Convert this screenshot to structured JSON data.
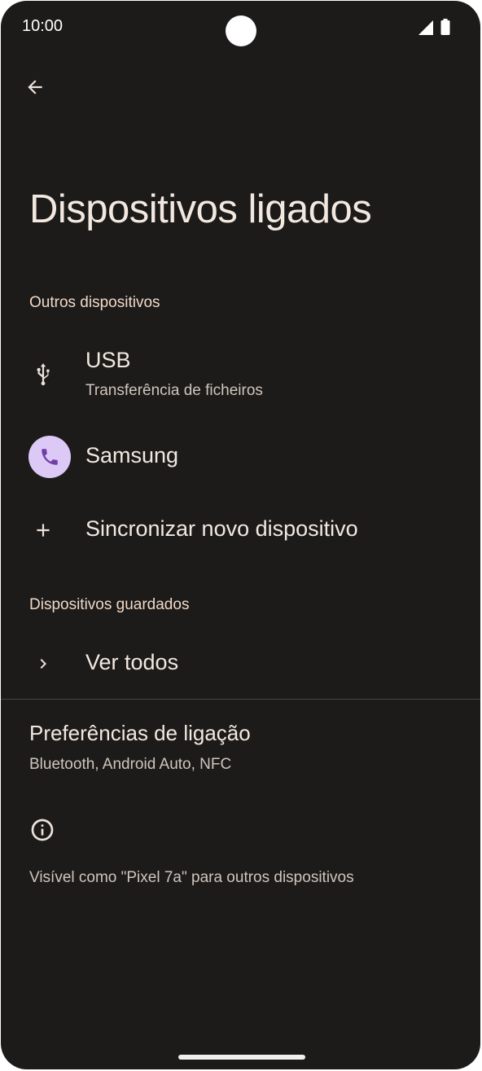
{
  "status_bar": {
    "time": "10:00",
    "icons": [
      "signal-icon",
      "battery-icon"
    ]
  },
  "header": {
    "back_icon": "arrow-back-icon",
    "title": "Dispositivos ligados"
  },
  "other_devices": {
    "section_title": "Outros dispositivos",
    "items": [
      {
        "icon": "usb-icon",
        "label": "USB",
        "subtitle": "Transferência de ficheiros"
      },
      {
        "icon": "phone-icon",
        "label": "Samsung"
      },
      {
        "icon": "plus-icon",
        "label": "Sincronizar novo dispositivo"
      }
    ]
  },
  "saved_devices": {
    "section_title": "Dispositivos guardados",
    "see_all_label": "Ver todos",
    "icon": "chevron-right-icon"
  },
  "connection_preferences": {
    "label": "Preferências de ligação",
    "subtitle": "Bluetooth, Android Auto, NFC"
  },
  "footer": {
    "icon": "info-icon",
    "text": "Visível como \"Pixel 7a\" para outros dispositivos"
  },
  "colors": {
    "background": "#1c1b1a",
    "accent_section": "#f1d8c6",
    "avatar_bg": "#ddc9f6",
    "avatar_icon": "#6f3fa8"
  }
}
